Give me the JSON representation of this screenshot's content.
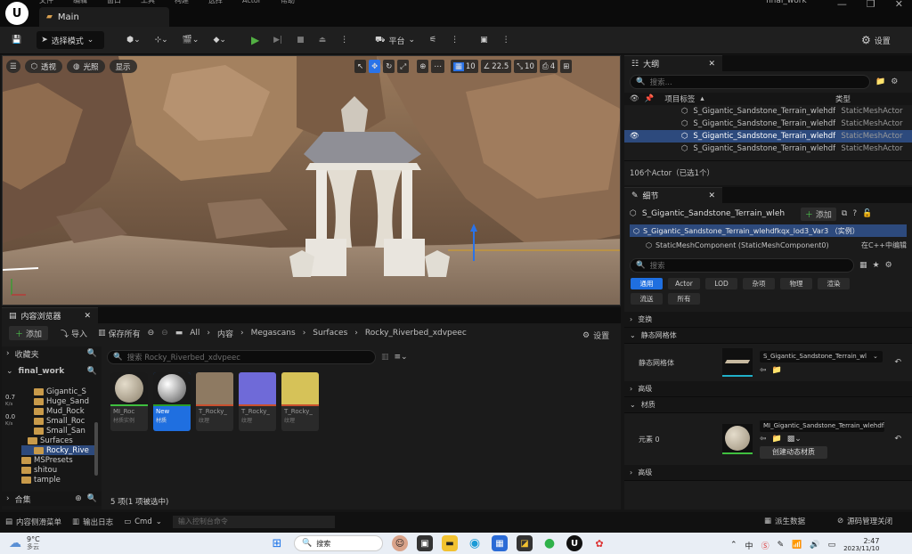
{
  "window": {
    "menu": [
      "文件",
      "编辑",
      "窗口",
      "工具",
      "构建",
      "选择",
      "Actor",
      "帮助"
    ],
    "tab": "Main",
    "project": "final_work",
    "controls": [
      "—",
      "❐",
      "✕"
    ]
  },
  "toolbar": {
    "select_mode": "选择模式",
    "platform": "平台",
    "settings": "设置"
  },
  "viewport": {
    "perspective": "透视",
    "lit": "光照",
    "show": "显示",
    "grid_snap": "10",
    "rot_snap": "22.5",
    "scale_snap": "10",
    "cam_speed": "4"
  },
  "outliner": {
    "title": "大纲",
    "search_placeholder": "搜索...",
    "col_label": "项目标签",
    "col_type": "类型",
    "rows": [
      {
        "name": "S_Gigantic_Sandstone_Terrain_wlehdf",
        "type": "StaticMeshActor",
        "selected": false
      },
      {
        "name": "S_Gigantic_Sandstone_Terrain_wlehdf",
        "type": "StaticMeshActor",
        "selected": false
      },
      {
        "name": "S_Gigantic_Sandstone_Terrain_wlehdf",
        "type": "StaticMeshActor",
        "selected": true
      },
      {
        "name": "S_Gigantic_Sandstone_Terrain_wlehdf",
        "type": "StaticMeshActor",
        "selected": false
      }
    ],
    "footer": "106个Actor（已选1个）"
  },
  "details": {
    "title": "细节",
    "actor_name": "S_Gigantic_Sandstone_Terrain_wleh",
    "add_label": "添加",
    "instance_row": "S_Gigantic_Sandstone_Terrain_wlehdfkqx_lod3_Var3 （实例）",
    "component_row": "StaticMeshComponent (StaticMeshComponent0)",
    "edit_cpp": "在C++中编辑",
    "search_placeholder": "搜索",
    "categories": [
      "通用",
      "Actor",
      "LOD",
      "杂项",
      "物理",
      "渲染",
      "流送",
      "所有"
    ],
    "sections": {
      "transform": "变换",
      "static_mesh": "静态网格体",
      "static_mesh_prop": "静态网格体",
      "static_mesh_value": "S_Gigantic_Sandstone_Terrain_wl",
      "advanced1": "高级",
      "materials": "材质",
      "element0": "元素 0",
      "material_value": "MI_Gigantic_Sandstone_Terrain_wlehdfl",
      "create_dynamic": "创建动态材质",
      "advanced2": "高级"
    }
  },
  "content_browser": {
    "title": "内容浏览器",
    "add": "添加",
    "import": "导入",
    "save_all": "保存所有",
    "breadcrumb": [
      "All",
      "内容",
      "Megascans",
      "Surfaces",
      "Rocky_Riverbed_xdvpeec"
    ],
    "settings": "设置",
    "favorites": "收藏夹",
    "project": "final_work",
    "search_placeholder": "搜索 Rocky_Riverbed_xdvpeec",
    "tree": [
      {
        "label": "Gigantic_S",
        "indent": 0
      },
      {
        "label": "Huge_Sand",
        "indent": 0
      },
      {
        "label": "Mud_Rock",
        "indent": 0
      },
      {
        "label": "Small_Roc",
        "indent": 0
      },
      {
        "label": "Small_San",
        "indent": 0
      },
      {
        "label": "Surfaces",
        "indent": -1
      },
      {
        "label": "Rocky_Rive",
        "indent": 0,
        "selected": true
      },
      {
        "label": "MSPresets",
        "indent": -2
      },
      {
        "label": "shitou",
        "indent": -2
      },
      {
        "label": "tample",
        "indent": -2
      }
    ],
    "stats": [
      {
        "v": "0.7",
        "u": "K/s"
      },
      {
        "v": "0.0",
        "u": "K/s"
      }
    ],
    "collections": "合集",
    "assets": [
      {
        "name": "MI_Roc",
        "type": "材质实例",
        "color": "#8a8577",
        "selected": false
      },
      {
        "name": "New",
        "type": "材质",
        "color": "#9a9a9a",
        "selected": true
      },
      {
        "name": "T_Rocky_",
        "type": "纹理",
        "color": "#8e7a62",
        "selected": false
      },
      {
        "name": "T_Rocky_",
        "type": "纹理",
        "color": "#6f6ad8",
        "selected": false
      },
      {
        "name": "T_Rocky_",
        "type": "纹理",
        "color": "#d6c258",
        "selected": false
      }
    ],
    "status": "5 项(1 项被选中)"
  },
  "bottom_bar": {
    "drawer": "内容侧滑菜单",
    "log": "输出日志",
    "cmd": "Cmd",
    "console_placeholder": "输入控制台命令",
    "derived": "派生数据",
    "source_control": "源码管理关闭"
  },
  "taskbar": {
    "weather_temp": "9°C",
    "weather_desc": "多云",
    "search": "搜索",
    "time": "2:47",
    "date": "2023/11/10",
    "ime": "中"
  }
}
